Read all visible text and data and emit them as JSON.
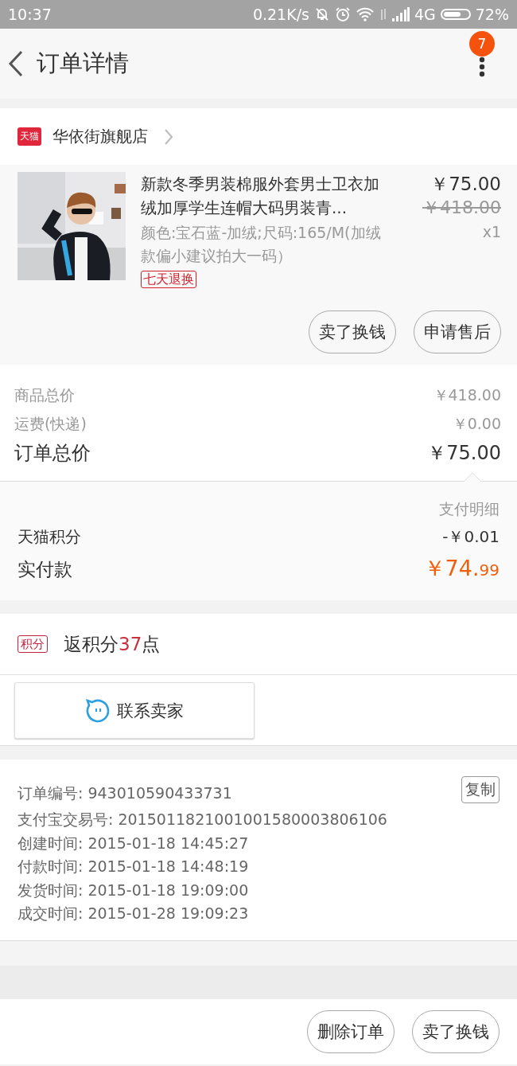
{
  "status_bar": {
    "time": "10:37",
    "network_speed": "0.21K/s",
    "network": "4G",
    "battery": "72%"
  },
  "header": {
    "title": "订单详情",
    "badge": "7"
  },
  "store": {
    "badge": "天猫",
    "name": "华依街旗舰店"
  },
  "product": {
    "kind": "picture",
    "title": "新款冬季男装棉服外套男士卫衣加绒加厚学生连帽大码男装青...",
    "sku": "颜色:宝石蓝-加绒;尺码:165/M(加绒款偏小建议拍大一码）",
    "tag": "七天退换",
    "price": "￥75.00",
    "original_price": "￥418.00",
    "quantity": "x1"
  },
  "item_actions": [
    "卖了换钱",
    "申请售后"
  ],
  "summary": [
    {
      "label": "商品总价",
      "value": "￥418.00",
      "kind": "minor"
    },
    {
      "label": "运费(快递)",
      "value": "￥0.00",
      "kind": "minor"
    },
    {
      "label": "订单总价",
      "value": "￥75.00",
      "kind": "total"
    }
  ],
  "payment": {
    "heading": "支付明细",
    "rows": [
      {
        "label": "天猫积分",
        "kind": "plain",
        "value_major": "-￥0.01"
      },
      {
        "label": "实付款",
        "kind": "paid",
        "value_major": "￥74.",
        "value_minor": "99"
      }
    ]
  },
  "points": {
    "tag": "积分",
    "prefix": "返积分",
    "number": "37",
    "suffix": "点"
  },
  "contact_button": "联系卖家",
  "order_info": {
    "copy_button": "复制",
    "lines": [
      {
        "label": "订单编号:",
        "value": "943010590433731"
      },
      {
        "label": "支付宝交易号:",
        "value": "2015011821001001580003806106"
      },
      {
        "label": "创建时间:",
        "value": "2015-01-18 14:45:27"
      },
      {
        "label": "付款时间:",
        "value": "2015-01-18 14:48:19"
      },
      {
        "label": "发货时间:",
        "value": "2015-01-18 19:09:00"
      },
      {
        "label": "成交时间:",
        "value": "2015-01-28 19:09:23"
      }
    ]
  },
  "bottom_actions": [
    "删除订单",
    "卖了换钱"
  ]
}
